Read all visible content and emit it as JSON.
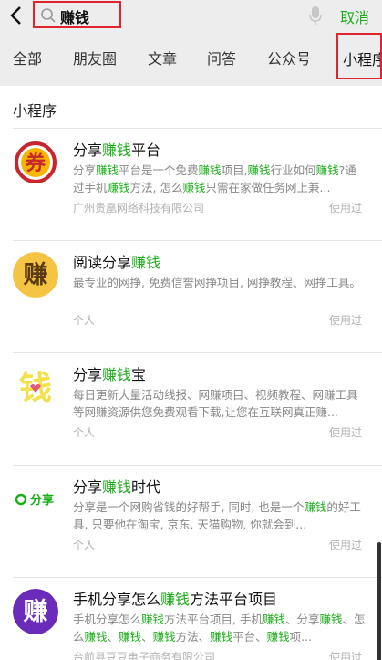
{
  "search": {
    "query": "赚钱",
    "cancel_label": "取消"
  },
  "tabs": [
    "全部",
    "朋友圈",
    "文章",
    "问答",
    "公众号",
    "小程序"
  ],
  "section_title": "小程序",
  "colors": {
    "highlight": "#1aad19",
    "annotation": "#e0242b"
  },
  "items": [
    {
      "title": [
        "分享",
        "赚钱",
        "平台"
      ],
      "desc": [
        [
          "分享",
          ""
        ],
        [
          "赚钱",
          "hl"
        ],
        [
          "平台是一个免费",
          ""
        ],
        [
          "赚钱",
          "hl"
        ],
        [
          "项目,",
          ""
        ],
        [
          "赚钱",
          "hl"
        ],
        [
          "行业如何",
          ""
        ],
        [
          "赚钱",
          "hl"
        ],
        [
          "?通过手机",
          ""
        ],
        [
          "赚钱",
          "hl"
        ],
        [
          "方法, 怎么",
          ""
        ],
        [
          "赚钱",
          "hl"
        ],
        [
          "只需在家做任务网上兼...",
          ""
        ]
      ],
      "company": "广州贵凰网络科技有限公司",
      "used": "使用过",
      "logo_icon": "coupon-logo-icon",
      "logo_char": "券"
    },
    {
      "title": [
        "阅读分享",
        "赚钱",
        ""
      ],
      "desc": [
        [
          "最专业的网挣, 免费信誉网挣项目, 网挣教程、网挣工具。",
          ""
        ]
      ],
      "company": "个人",
      "used": "使用过",
      "logo_icon": "earn-logo-icon",
      "logo_char": "赚"
    },
    {
      "title": [
        "分享",
        "赚钱",
        "宝"
      ],
      "desc": [
        [
          "每日更新大量活动线报、网赚项目、视频教程、网赚工具等网赚资源供您免费观看下载,让您在互联网真正赚...",
          ""
        ]
      ],
      "company": "个人",
      "used": "使用过",
      "logo_icon": "money-logo-icon",
      "logo_char": "钱"
    },
    {
      "title": [
        "分享",
        "赚钱",
        "时代"
      ],
      "desc": [
        [
          "分享是一个网购省钱的好帮手, 同时, 也是一个",
          ""
        ],
        [
          "赚钱",
          "hl"
        ],
        [
          "的好工具, 只要他在淘宝, 京东, 天猫购物, 你就会到...",
          ""
        ]
      ],
      "company": "个人",
      "used": "使用过",
      "logo_icon": "share-logo-icon",
      "logo_char": "分享"
    },
    {
      "title": [
        "手机分享怎么",
        "赚钱",
        "方法平台项目"
      ],
      "desc": [
        [
          "手机分享怎么",
          ""
        ],
        [
          "赚钱",
          "hl"
        ],
        [
          "方法平台项目, 手机",
          ""
        ],
        [
          "赚钱",
          "hl"
        ],
        [
          "、分享",
          ""
        ],
        [
          "赚钱",
          "hl"
        ],
        [
          "、怎么",
          ""
        ],
        [
          "赚钱",
          "hl"
        ],
        [
          "、",
          ""
        ],
        [
          "赚钱",
          "hl"
        ],
        [
          "、",
          ""
        ],
        [
          "赚钱",
          "hl"
        ],
        [
          "方法、",
          ""
        ],
        [
          "赚钱",
          "hl"
        ],
        [
          "平台、",
          ""
        ],
        [
          "赚钱",
          "hl"
        ],
        [
          "项...",
          ""
        ]
      ],
      "company": "台前县豆豆电子商务有限公司",
      "used": "使用过",
      "logo_icon": "earn-purple-logo-icon",
      "logo_char": "赚"
    }
  ]
}
